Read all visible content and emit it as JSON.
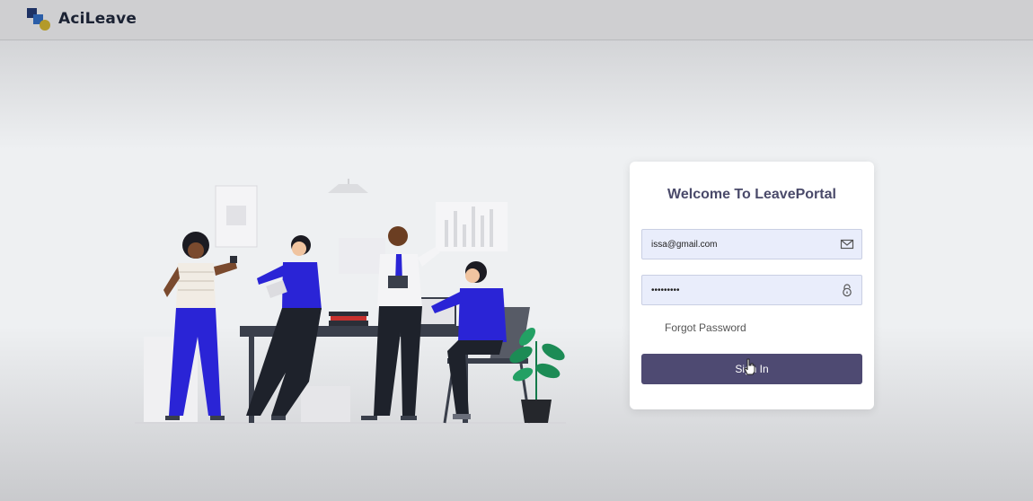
{
  "header": {
    "brand": "AciLeave",
    "logo_icon": "overlapping-squares-logo"
  },
  "login": {
    "title": "Welcome To LeavePortal",
    "email": {
      "value": "issa@gmail.com",
      "icon": "envelope-icon"
    },
    "password": {
      "value": "•••••••••",
      "icon": "lock-icon"
    },
    "forgot_password": "Forgot Password",
    "submit_label": "Sign In"
  },
  "colors": {
    "brand_text": "#1b2233",
    "primary_button": "#4e4a72",
    "input_bg": "#e9edfb",
    "title": "#4a4a6a",
    "illustration_accent": "#2a24d6"
  }
}
